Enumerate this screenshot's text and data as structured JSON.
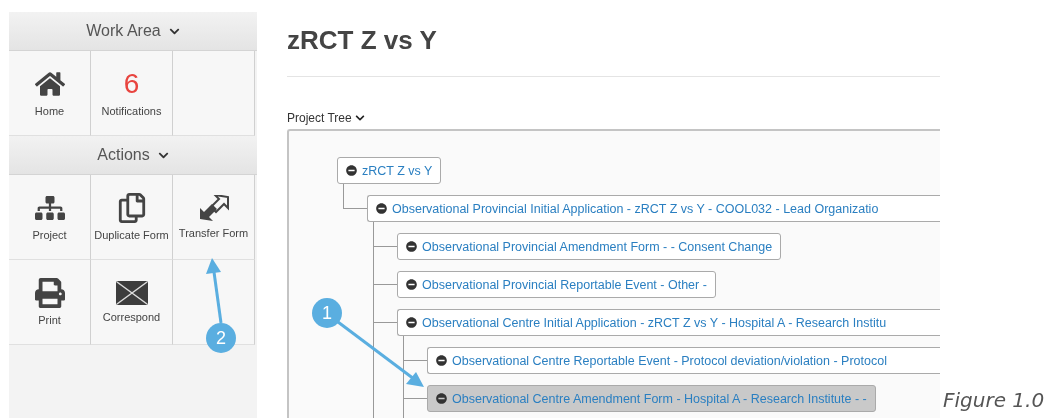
{
  "sidebar": {
    "sections": [
      {
        "title": "Work Area",
        "tiles": [
          {
            "kind": "home",
            "label": "Home"
          },
          {
            "kind": "count",
            "count": "6",
            "label": "Notifications"
          }
        ]
      },
      {
        "title": "Actions",
        "tiles": [
          {
            "kind": "sitemap",
            "label": "Project"
          },
          {
            "kind": "duplicate",
            "label": "Duplicate Form"
          },
          {
            "kind": "transfer",
            "label": "Transfer Form"
          },
          {
            "kind": "print",
            "label": "Print"
          },
          {
            "kind": "mail",
            "label": "Correspond"
          }
        ]
      }
    ]
  },
  "page": {
    "title": "zRCT Z vs Y",
    "tree_label": "Project Tree",
    "tree": [
      {
        "label": "zRCT Z vs Y",
        "expanded": true,
        "selected": false,
        "children": [
          {
            "label": "Observational Provincial Initial Application - zRCT Z vs Y - COOL032 - Lead Organizatio",
            "expanded": true,
            "selected": false,
            "children": [
              {
                "label": "Observational Provincial Amendment Form - - Consent Change",
                "expanded": true,
                "selected": false
              },
              {
                "label": "Observational Provincial Reportable Event - Other -",
                "expanded": true,
                "selected": false
              },
              {
                "label": "Observational Centre Initial Application - zRCT Z vs Y - Hospital A - Research Institu",
                "expanded": true,
                "selected": false,
                "children": [
                  {
                    "label": "Observational Centre Reportable Event - Protocol deviation/violation - Protocol",
                    "expanded": true,
                    "selected": false
                  },
                  {
                    "label": "Observational Centre Amendment Form - Hospital A - Research Institute - -",
                    "expanded": true,
                    "selected": true
                  }
                ]
              }
            ]
          }
        ]
      }
    ]
  },
  "annotations": [
    {
      "label": "1"
    },
    {
      "label": "2"
    }
  ],
  "caption": "Figure 1.0"
}
